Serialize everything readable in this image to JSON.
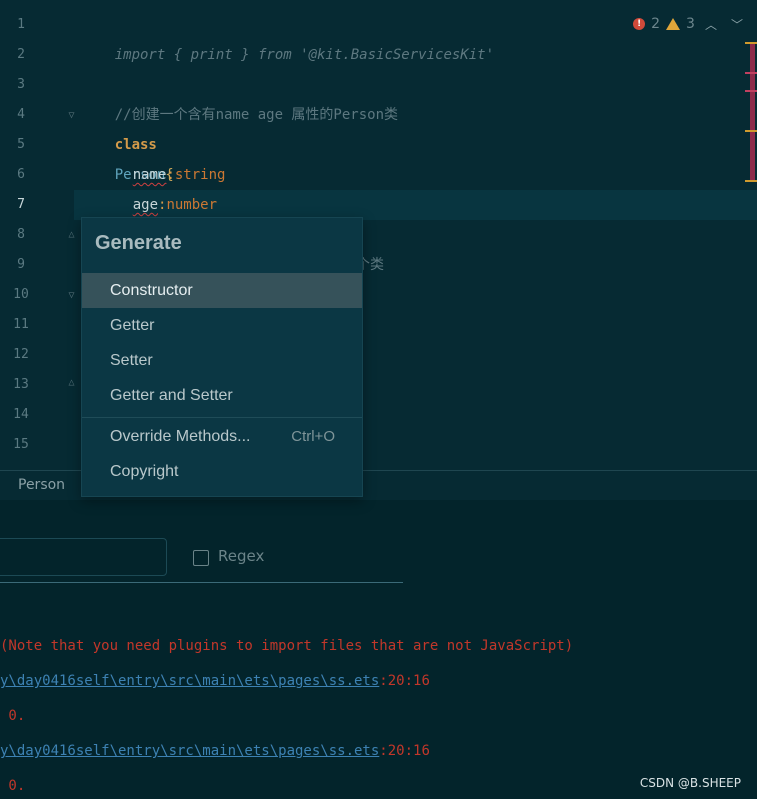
{
  "editor": {
    "line_numbers": [
      "1",
      "2",
      "3",
      "4",
      "5",
      "6",
      "7",
      "8",
      "9",
      "10",
      "11",
      "12",
      "13",
      "14",
      "15"
    ],
    "active_line": "7",
    "code": {
      "line1": "import { print } from '@kit.BasicServicesKit'",
      "line3": "//创建一个含有name age 属性的Person类",
      "line4_keyword": "class",
      "line4_name": "Person",
      "line4_brace": "{",
      "line5_prop": "name",
      "line5_colon": ":",
      "line5_type": "string",
      "line6_prop": "age",
      "line6_colon": ":",
      "line6_type": "number",
      "line9_fragment": "个类"
    },
    "status": {
      "errors": "2",
      "warnings": "3",
      "error_icon": "error-icon",
      "warning_icon": "warning-icon"
    }
  },
  "breadcrumb": {
    "item": "Person"
  },
  "find": {
    "regex_label": "Regex"
  },
  "output": {
    "line1": "(Note that you need plugins to import files that are not JavaScript)",
    "line2_link": "y\\day0416self\\entry\\src\\main\\ets\\pages\\ss.ets",
    "line2_loc": ":20:16",
    "line3": " 0.",
    "line4_link": "y\\day0416self\\entry\\src\\main\\ets\\pages\\ss.ets",
    "line4_loc": ":20:16",
    "line5": " 0."
  },
  "popup": {
    "title": "Generate",
    "items": [
      {
        "label": "Constructor",
        "shortcut": ""
      },
      {
        "label": "Getter",
        "shortcut": ""
      },
      {
        "label": "Setter",
        "shortcut": ""
      },
      {
        "label": "Getter and Setter",
        "shortcut": ""
      },
      {
        "label": "Override Methods...",
        "shortcut": "Ctrl+O"
      },
      {
        "label": "Copyright",
        "shortcut": ""
      }
    ],
    "selected_index": 0
  },
  "watermark": "CSDN @B.SHEEP",
  "colors": {
    "background": "#062a33",
    "popup_bg": "#0b3744",
    "selection": "#36525a",
    "error": "#c2372a",
    "link": "#3d82b3"
  }
}
